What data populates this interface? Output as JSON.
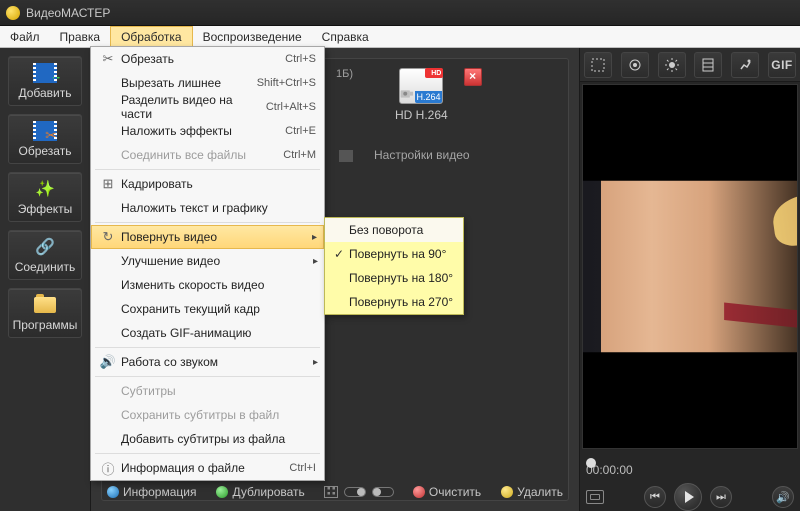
{
  "app_title": "ВидеоМАСТЕР",
  "menubar": [
    "Файл",
    "Правка",
    "Обработка",
    "Воспроизведение",
    "Справка"
  ],
  "active_menu_index": 2,
  "sidebar": [
    {
      "id": "add",
      "label": "Добавить"
    },
    {
      "id": "cut",
      "label": "Обрезать"
    },
    {
      "id": "fx",
      "label": "Эффекты"
    },
    {
      "id": "join",
      "label": "Соединить"
    },
    {
      "id": "prog",
      "label": "Программы"
    }
  ],
  "dropdown": [
    {
      "label": "Обрезать",
      "shortcut": "Ctrl+S",
      "icon": "scissors"
    },
    {
      "label": "Вырезать лишнее",
      "shortcut": "Shift+Ctrl+S"
    },
    {
      "label": "Разделить видео на части",
      "shortcut": "Ctrl+Alt+S"
    },
    {
      "label": "Наложить эффекты",
      "shortcut": "Ctrl+E"
    },
    {
      "label": "Соединить все файлы",
      "shortcut": "Ctrl+M",
      "disabled": true
    },
    {
      "sep": true
    },
    {
      "label": "Кадрировать",
      "icon": "crop"
    },
    {
      "label": "Наложить текст и графику"
    },
    {
      "sep": true
    },
    {
      "label": "Повернуть видео",
      "icon": "rotate",
      "hover": true,
      "submenu": true
    },
    {
      "label": "Улучшение видео",
      "submenu": true
    },
    {
      "label": "Изменить скорость видео"
    },
    {
      "label": "Сохранить текущий кадр"
    },
    {
      "label": "Создать GIF-анимацию"
    },
    {
      "sep": true
    },
    {
      "label": "Работа со звуком",
      "icon": "sound",
      "submenu": true
    },
    {
      "sep": true
    },
    {
      "label": "Субтитры",
      "disabled": true
    },
    {
      "label": "Сохранить субтитры в файл",
      "disabled": true
    },
    {
      "label": "Добавить субтитры из файла"
    },
    {
      "sep": true
    },
    {
      "label": "Информация о файле",
      "shortcut": "Ctrl+I",
      "icon": "info"
    }
  ],
  "submenu": [
    {
      "label": "Без поворота",
      "light": true
    },
    {
      "label": "Повернуть на 90°",
      "checked": true
    },
    {
      "label": "Повернуть на 180°"
    },
    {
      "label": "Повернуть на 270°"
    }
  ],
  "content": {
    "size_suffix": "1Б)",
    "settings_label": "Настройки видео",
    "codec_bar": "H.264",
    "codec_label": "HD H.264",
    "hd_badge": "HD"
  },
  "bottombar": {
    "info": "Информация",
    "dup": "Дублировать",
    "clear": "Очистить",
    "del": "Удалить"
  },
  "preview": {
    "toolbar_names": [
      "crop-tool",
      "levels-tool",
      "brightness-tool",
      "effects-tool",
      "speed-tool",
      "gif-tool"
    ],
    "gif_label": "GIF",
    "time": "00:00:00"
  }
}
